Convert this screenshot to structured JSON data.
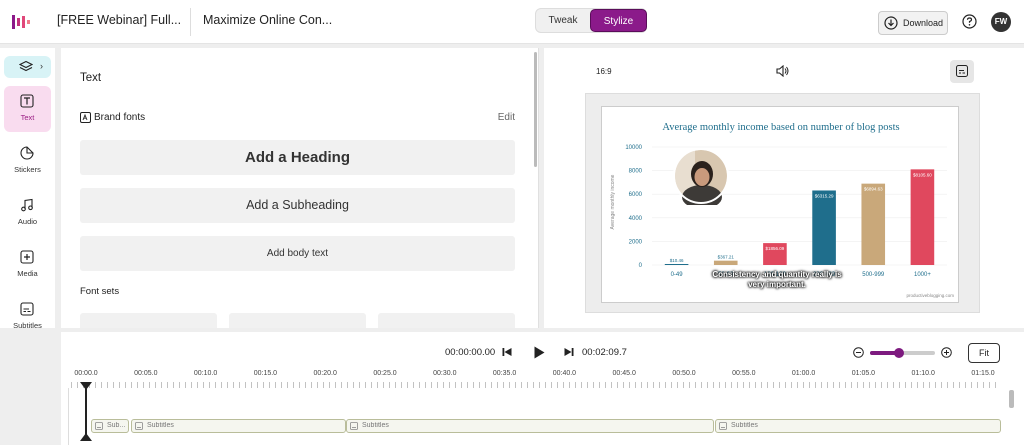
{
  "header": {
    "project_title": "[FREE Webinar] Full...",
    "video_title": "Maximize Online Con...",
    "mode_tweak": "Tweak",
    "mode_stylize": "Stylize",
    "download_label": "Download",
    "avatar_initials": "FW",
    "logo_icon": "waveform-logo-icon",
    "accent_color": "#8b1a8a"
  },
  "sidebar": {
    "items": [
      {
        "label": "Text",
        "icon": "text-icon"
      },
      {
        "label": "Stickers",
        "icon": "sticker-icon"
      },
      {
        "label": "Audio",
        "icon": "music-note-icon"
      },
      {
        "label": "Media",
        "icon": "add-media-icon"
      },
      {
        "label": "Subtitles",
        "icon": "subtitles-icon"
      }
    ]
  },
  "text_panel": {
    "title": "Text",
    "brand_fonts_label": "Brand fonts",
    "edit_label": "Edit",
    "add_heading": "Add a Heading",
    "add_subheading": "Add a Subheading",
    "add_body": "Add body text",
    "font_sets_label": "Font sets"
  },
  "preview": {
    "aspect_ratio": "16:9",
    "caption": "Consistency and quantity really is very important.",
    "slide": {
      "title": "Average monthly income based on number of blog posts",
      "ylabel": "Average monthly income",
      "watermark": "productiveblogging.com"
    }
  },
  "chart_data": {
    "type": "bar",
    "title": "Average monthly income based on number of blog posts",
    "ylabel": "Average monthly income",
    "xlabel": "",
    "categories": [
      "0-49",
      "50-99",
      "100-199",
      "200-499",
      "500-999",
      "1000+"
    ],
    "values": [
      10.46,
      367.21,
      1856.09,
      6315.29,
      6894.63,
      8105.6
    ],
    "value_labels": [
      "$10.46",
      "$367.21",
      "$1856.09",
      "$6315.29",
      "$6894.63",
      "$8105.60"
    ],
    "colors": [
      "#1f6e8c",
      "#c9a87a",
      "#e0485e",
      "#1f6e8c",
      "#c9a87a",
      "#e0485e"
    ],
    "yticks": [
      "0",
      "2000",
      "4000",
      "6000",
      "8000",
      "10000"
    ],
    "ylim": [
      0,
      10000
    ],
    "grid": true
  },
  "timeline": {
    "current_time": "00:00:00.00",
    "total_time": "00:02:09.7",
    "fit_label": "Fit",
    "zoom_level": 0.45,
    "ruler_labels": [
      "00:00.0",
      "00:05.0",
      "00:10.0",
      "00:15.0",
      "00:20.0",
      "00:25.0",
      "00:30.0",
      "00:35.0",
      "00:40.0",
      "00:45.0",
      "00:50.0",
      "00:55.0",
      "01:00.0",
      "01:05.0",
      "01:10.0",
      "01:15.0"
    ],
    "clips": [
      "Sub...",
      "Subtitles",
      "Subtitles",
      "Subtitles"
    ]
  }
}
